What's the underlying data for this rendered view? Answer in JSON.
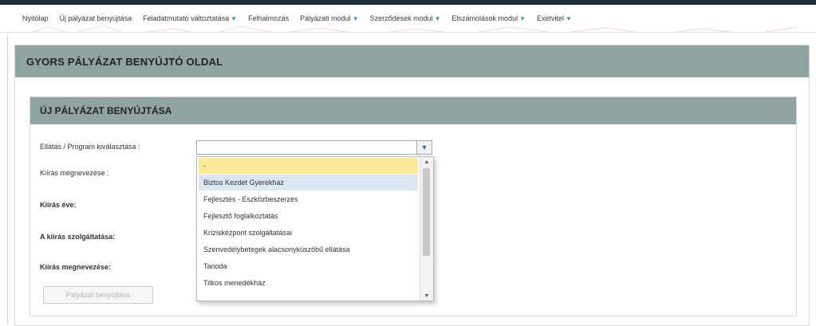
{
  "nav": {
    "items": [
      {
        "label": "Nyitólap",
        "dropdown": false
      },
      {
        "label": "Új pályázat benyújtása",
        "dropdown": false
      },
      {
        "label": "Feladatmutató változtatása",
        "dropdown": true
      },
      {
        "label": "Felhalmozás",
        "dropdown": false
      },
      {
        "label": "Pályázati modul",
        "dropdown": true
      },
      {
        "label": "Szerződések modul",
        "dropdown": true
      },
      {
        "label": "Elszámolások modul",
        "dropdown": true
      },
      {
        "label": "Exetvitel",
        "dropdown": true
      }
    ],
    "caret": "▼"
  },
  "page": {
    "title": "GYORS PÁLYÁZAT BENYÚJTÓ OLDAL"
  },
  "panel": {
    "title": "ÚJ PÁLYÁZAT BENYÚJTÁSA",
    "fields": {
      "program_label": "Ellátás / Program kiválasztása :",
      "kiiras_nev_label": "Kiírás megnevezése :",
      "kiiras_eve_label": "Kiírás éve:",
      "szolgaltatas_label": "A kiírás szolgáltatása:",
      "kiiras_nev2_label": "Kiírás megnevezése:"
    },
    "select": {
      "value": "",
      "button_icon": "▼"
    },
    "dropdown_options": [
      "-",
      "Biztos Kezdet Gyerekház",
      "Fejlesztés - Eszközbeszerzés",
      "Fejlesztő foglalkoztatás",
      "Kríziskézpont szolgáltatásai",
      "Szenvedélybetegek alacsonyküszöbű ellátása",
      "Tanoda",
      "Titkos menedékház"
    ],
    "scroll_up": "▲",
    "scroll_down": "▼",
    "submit_label": "Pályázat benyújtása"
  },
  "colors": {
    "header_bg": "#8fa3a3",
    "highlight": "#fde99a",
    "hover": "#dbe8f3"
  }
}
